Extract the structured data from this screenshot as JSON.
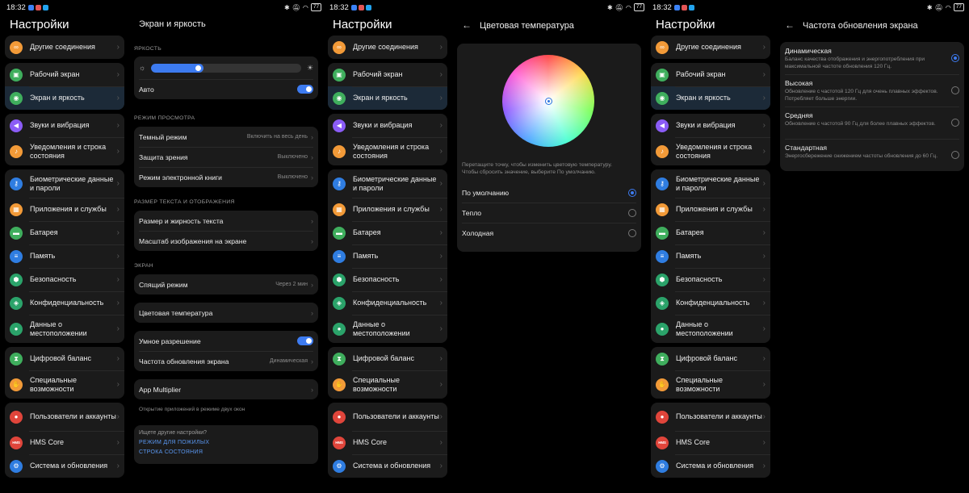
{
  "status": {
    "time": "18:32",
    "battery": "77"
  },
  "nav": {
    "title": "Настройки",
    "groups": [
      {
        "items": [
          {
            "label": "Другие соединения",
            "icon": "link-icon",
            "color": "#f29a38"
          }
        ]
      },
      {
        "items": [
          {
            "label": "Рабочий экран",
            "icon": "image-icon",
            "color": "#3fae5d"
          },
          {
            "label": "Экран и яркость",
            "icon": "eye-icon",
            "color": "#3fae5d"
          }
        ]
      },
      {
        "items": [
          {
            "label": "Звуки и вибрация",
            "icon": "speaker-icon",
            "color": "#8b5cf6"
          },
          {
            "label": "Уведомления и строка состояния",
            "icon": "bell-icon",
            "color": "#f29a38"
          }
        ]
      },
      {
        "items": [
          {
            "label": "Биометрические данные и пароли",
            "icon": "key-icon",
            "color": "#2f7de1"
          },
          {
            "label": "Приложения и службы",
            "icon": "apps-icon",
            "color": "#f29a38"
          },
          {
            "label": "Батарея",
            "icon": "battery-icon",
            "color": "#3fae5d"
          },
          {
            "label": "Память",
            "icon": "storage-icon",
            "color": "#2f7de1"
          },
          {
            "label": "Безопасность",
            "icon": "shield-icon",
            "color": "#2ba36a"
          },
          {
            "label": "Конфиденциальность",
            "icon": "privacy-icon",
            "color": "#2ba36a"
          },
          {
            "label": "Данные о местоположении",
            "icon": "location-icon",
            "color": "#2ba36a"
          }
        ]
      },
      {
        "items": [
          {
            "label": "Цифровой баланс",
            "icon": "hourglass-icon",
            "color": "#3fae5d"
          },
          {
            "label": "Специальные возможности",
            "icon": "hand-icon",
            "color": "#f29a38"
          }
        ]
      },
      {
        "items": [
          {
            "label": "Пользователи и аккаунты",
            "icon": "user-icon",
            "color": "#e0453b"
          },
          {
            "label": "HMS Core",
            "icon": "hms-icon",
            "color": "#e0453b"
          },
          {
            "label": "Система и обновления",
            "icon": "gear-icon",
            "color": "#2f7de1"
          }
        ]
      }
    ]
  },
  "display": {
    "title": "Экран и яркость",
    "brightness_header": "ЯРКОСТЬ",
    "brightness_level": 0.35,
    "auto_label": "Авто",
    "mode_header": "РЕЖИМ ПРОСМОТРА",
    "dark_mode_label": "Темный режим",
    "dark_mode_value": "Включить на весь день",
    "eye_comfort_label": "Защита зрения",
    "eye_comfort_value": "Выключено",
    "ebook_label": "Режим электронной книги",
    "ebook_value": "Выключено",
    "text_header": "РАЗМЕР ТЕКСТА И ОТОБРАЖЕНИЯ",
    "text_size_label": "Размер и жирность текста",
    "scale_label": "Масштаб изображения на экране",
    "screen_header": "ЭКРАН",
    "sleep_label": "Спящий режим",
    "sleep_value": "Через 2 мин",
    "color_temp_label": "Цветовая температура",
    "smart_res_label": "Умное разрешение",
    "refresh_label": "Частота обновления экрана",
    "refresh_value": "Динамическая",
    "app_multiplier_label": "App Multiplier",
    "app_multiplier_note": "Открытие приложений в режиме двух окон",
    "search_question": "Ищете другие настройки?",
    "search_link1": "РЕЖИМ ДЛЯ ПОЖИЛЫХ",
    "search_link2": "СТРОКА СОСТОЯНИЯ"
  },
  "color_temp": {
    "title": "Цветовая температура",
    "hint_line1": "Перетащите точку, чтобы изменить цветовую температуру.",
    "hint_line2": "Чтобы сбросить значение, выберите По умолчанию.",
    "options": [
      {
        "label": "По умолчанию",
        "selected": true
      },
      {
        "label": "Тепло",
        "selected": false
      },
      {
        "label": "Холодная",
        "selected": false
      }
    ]
  },
  "refresh": {
    "title": "Частота обновления экрана",
    "options": [
      {
        "title": "Динамическая",
        "desc": "Баланс качества отображения и энергопотребления при максимальной частоте обновления 120 Гц.",
        "selected": true
      },
      {
        "title": "Высокая",
        "desc": "Обновление с частотой 120 Гц для очень плавных эффектов. Потребляет больше энергии.",
        "selected": false
      },
      {
        "title": "Средняя",
        "desc": "Обновление с частотой 90 Гц для более плавных эффектов.",
        "selected": false
      },
      {
        "title": "Стандартная",
        "desc": "Энергосбережение снижением частоты обновления до 60 Гц.",
        "selected": false
      }
    ]
  }
}
